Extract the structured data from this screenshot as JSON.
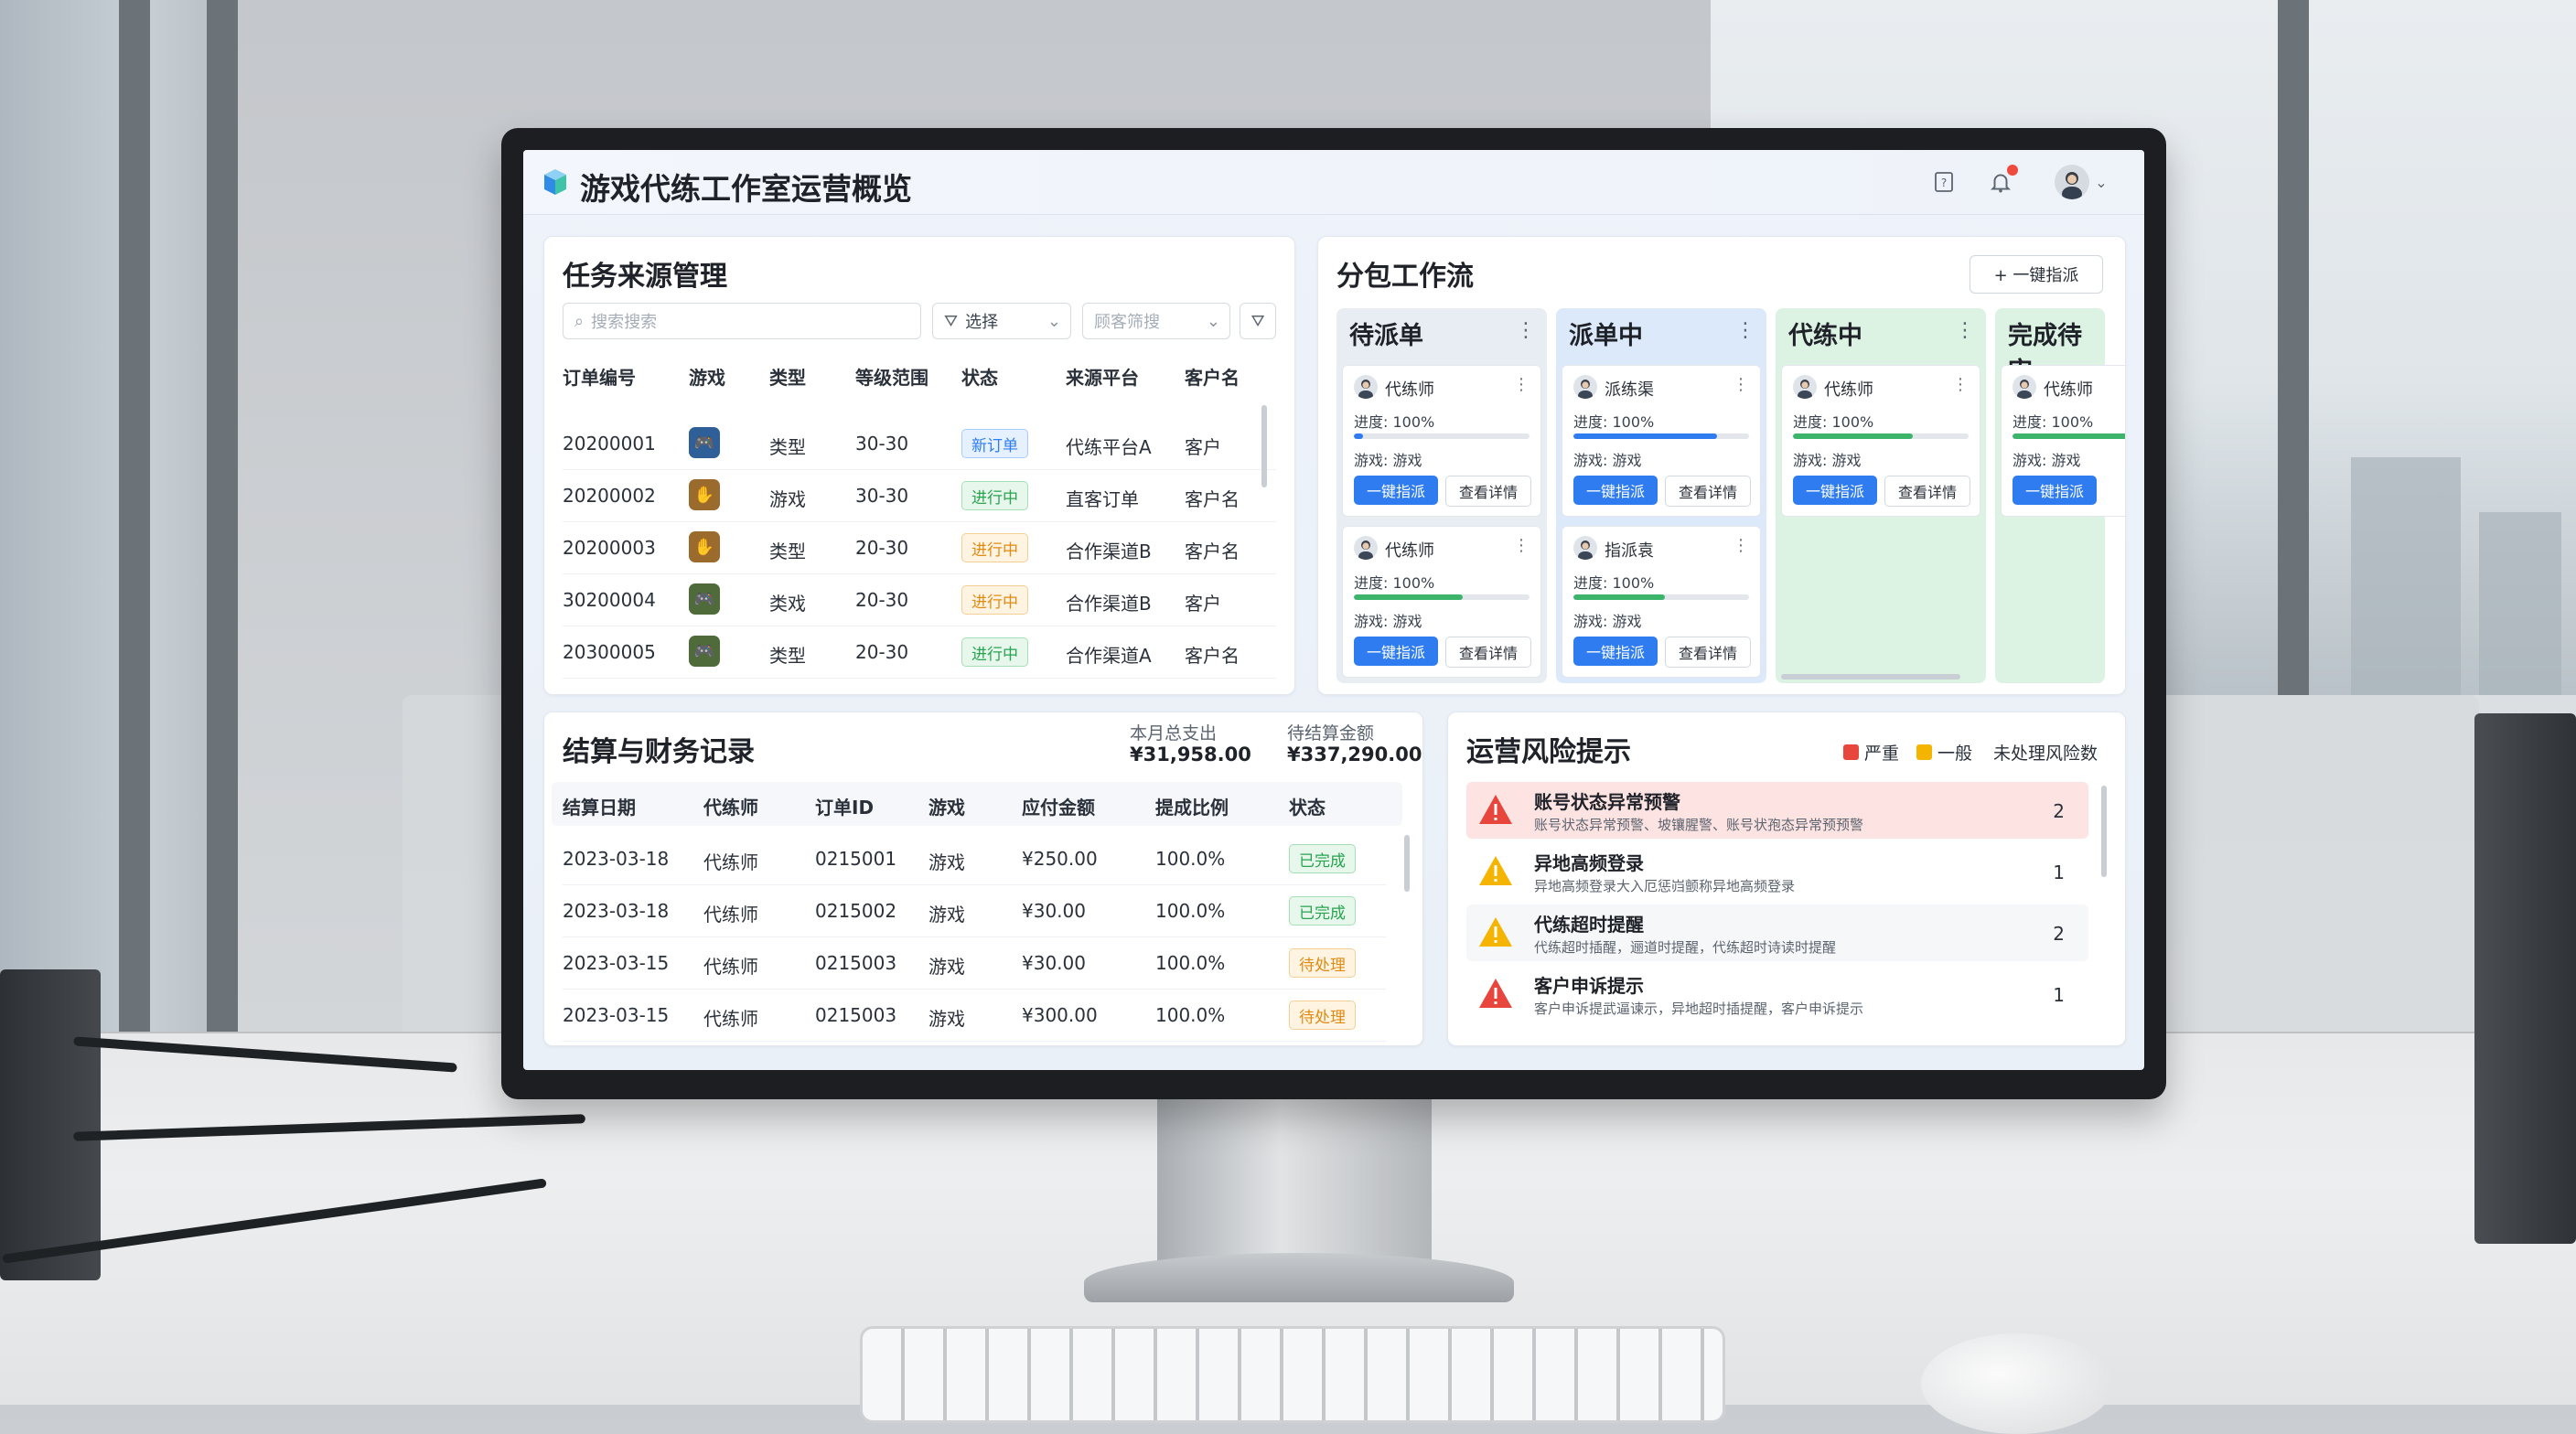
{
  "app": {
    "title": "游戏代练工作室运营概览"
  },
  "task_source": {
    "title": "任务来源管理",
    "search_placeholder": "搜索搜索",
    "select_label": "选择",
    "select2_label": "顾客筛搜",
    "columns": [
      "订单编号",
      "游戏",
      "类型",
      "等级范围",
      "状态",
      "来源平台",
      "客户名"
    ],
    "rows": [
      {
        "id": "20200001",
        "game_icon": "gamepad-icon",
        "type": "类型",
        "level": "30-30",
        "status": "新订单",
        "status_color": "blue",
        "platform": "代练平台A",
        "customer": "客户"
      },
      {
        "id": "20200002",
        "game_icon": "hand-icon",
        "type": "游戏",
        "level": "30-30",
        "status": "进行中",
        "status_color": "green",
        "platform": "直客订单",
        "customer": "客户名"
      },
      {
        "id": "20200003",
        "game_icon": "hand-icon",
        "type": "类型",
        "level": "20-30",
        "status": "进行中",
        "status_color": "orange",
        "platform": "合作渠道B",
        "customer": "客户名"
      },
      {
        "id": "30200004",
        "game_icon": "gamepad-icon",
        "type": "类戏",
        "level": "20-30",
        "status": "进行中",
        "status_color": "orange",
        "platform": "合作渠道B",
        "customer": "客户"
      },
      {
        "id": "20300005",
        "game_icon": "gamepad-icon",
        "type": "类型",
        "level": "20-30",
        "status": "进行中",
        "status_color": "green",
        "platform": "合作渠道A",
        "customer": "客户名"
      }
    ]
  },
  "workflow": {
    "title": "分包工作流",
    "add_button": "+ 一键指派",
    "columns": [
      {
        "title": "待派单",
        "color": "#e8ecf3",
        "cards": [
          {
            "name": "代练师",
            "progress_label": "进度: 100%",
            "progress": 0.05,
            "bar_color": "#2f7cf0",
            "game": "游戏: 游戏",
            "primary": "一键指派",
            "secondary": "查看详情"
          },
          {
            "name": "代练师",
            "progress_label": "进度: 100%",
            "progress": 0.62,
            "bar_color": "#3cb56a",
            "game": "游戏: 游戏",
            "primary": "一键指派",
            "secondary": "查看详情"
          }
        ]
      },
      {
        "title": "派单中",
        "color": "#dce9fb",
        "cards": [
          {
            "name": "派练渠",
            "progress_label": "进度: 100%",
            "progress": 0.82,
            "bar_color": "#2f7cf0",
            "game": "游戏: 游戏",
            "primary": "一键指派",
            "secondary": "查看详情"
          },
          {
            "name": "指派袁",
            "progress_label": "进度: 100%",
            "progress": 0.52,
            "bar_color": "#3cb56a",
            "game": "游戏: 游戏",
            "primary": "一键指派",
            "secondary": "查看详情"
          }
        ]
      },
      {
        "title": "代练中",
        "color": "#dcf2e2",
        "cards": [
          {
            "name": "代练师",
            "progress_label": "进度: 100%",
            "progress": 0.68,
            "bar_color": "#3cb56a",
            "game": "游戏: 游戏",
            "primary": "一键指派",
            "secondary": "查看详情"
          }
        ]
      },
      {
        "title": "完成待审",
        "color": "#dcf2e2",
        "cards": [
          {
            "name": "代练师",
            "progress_label": "进度: 100%",
            "progress": 1.0,
            "bar_color": "#3cb56a",
            "game": "游戏: 游戏",
            "primary": "一键指派",
            "secondary": ""
          }
        ]
      }
    ]
  },
  "finance": {
    "title": "结算与财务记录",
    "month_spend_label": "本月总支出",
    "month_spend": "¥31,958.00",
    "pending_label": "待结算金额",
    "pending": "¥337,290.00",
    "columns": [
      "结算日期",
      "代练师",
      "订单ID",
      "游戏",
      "应付金额",
      "提成比例",
      "状态"
    ],
    "rows": [
      {
        "date": "2023-03-18",
        "worker": "代练师",
        "order": "0215001",
        "game": "游戏",
        "amount": "¥250.00",
        "ratio": "100.0%",
        "status": "已完成",
        "status_color": "green"
      },
      {
        "date": "2023-03-18",
        "worker": "代练师",
        "order": "0215002",
        "game": "游戏",
        "amount": "¥30.00",
        "ratio": "100.0%",
        "status": "已完成",
        "status_color": "green"
      },
      {
        "date": "2023-03-15",
        "worker": "代练师",
        "order": "0215003",
        "game": "游戏",
        "amount": "¥30.00",
        "ratio": "100.0%",
        "status": "待处理",
        "status_color": "orange"
      },
      {
        "date": "2023-03-15",
        "worker": "代练师",
        "order": "0215003",
        "game": "游戏",
        "amount": "¥300.00",
        "ratio": "100.0%",
        "status": "待处理",
        "status_color": "orange"
      }
    ]
  },
  "risk": {
    "title": "运营风险提示",
    "legend_severe": "严重",
    "legend_normal": "一般",
    "legend_count": "未处理风险数",
    "severe_color": "#e8453c",
    "normal_color": "#f5b400",
    "items": [
      {
        "title": "账号状态异常预警",
        "desc": "账号状态异常预警、坡镶腥警、账号状孢态异常预预警",
        "count": "2",
        "level": "severe"
      },
      {
        "title": "异地高频登录",
        "desc": "异地高频登录大入厄惩岿颤称异地高频登录",
        "count": "1",
        "level": "normal"
      },
      {
        "title": "代练超时提醒",
        "desc": "代练超时插醒，逦道时提醒，代练超时诗读时提醒",
        "count": "2",
        "level": "normal"
      },
      {
        "title": "客户申诉提示",
        "desc": "客户申诉提武逼谏示，异地超时插提醒，客户申诉提示",
        "count": "1",
        "level": "severe"
      }
    ]
  }
}
